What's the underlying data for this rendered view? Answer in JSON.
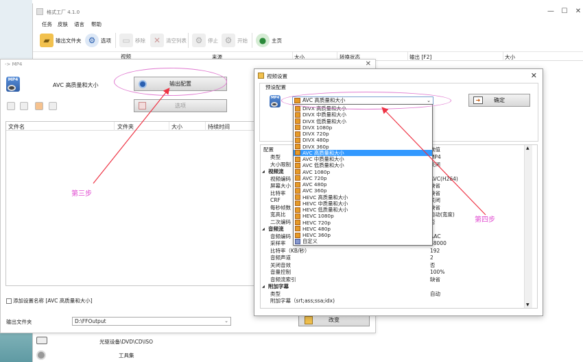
{
  "main_window": {
    "title": "格式工厂 4.1.0",
    "controls": {
      "minimize": "—",
      "maximize": "☐",
      "close": "✕"
    },
    "menu": [
      "任务",
      "皮肤",
      "语言",
      "帮助"
    ],
    "toolbar": {
      "output_folder": "输出文件夹",
      "options": "选项",
      "remove": "移除",
      "clear_list": "清空列表",
      "stop": "停止",
      "start": "开始",
      "home": "主页"
    },
    "list_columns": [
      "来源",
      "大小",
      "转换状态",
      "输出 [F2]",
      "大小"
    ],
    "video_label": "视频",
    "bottom_items": [
      "光驱设备\\DVD\\CD\\ISO",
      "工具集"
    ]
  },
  "mp4_window": {
    "title": "-> MP4",
    "profile_name": "AVC 高质量和大小",
    "output_config_button": "输出配置",
    "options_button": "选项",
    "file_columns": [
      "文件名",
      "文件夹",
      "大小",
      "持续时间"
    ],
    "add_setting_name": "添加设置名称 [AVC 高质量和大小]",
    "output_folder_label": "输出文件夹",
    "output_folder_value": "D:\\FFOutput",
    "change_button": "改变"
  },
  "video_dialog": {
    "title": "视频设置",
    "preset_label": "预设配置",
    "preset_selected": "AVC 高质量和大小",
    "ok_button": "确定",
    "grid_header": [
      "配置",
      "数值"
    ],
    "rows": [
      {
        "k": "类型",
        "v": "MP4",
        "cat": false
      },
      {
        "k": "大小限制（",
        "v": "关闭",
        "cat": false
      },
      {
        "k": "视频流",
        "v": "",
        "cat": true
      },
      {
        "k": "视频编码",
        "v": "AVC(H264)",
        "cat": false
      },
      {
        "k": "屏幕大小",
        "v": "缺省",
        "cat": false
      },
      {
        "k": "比特率",
        "v": "缺省",
        "cat": false
      },
      {
        "k": "CRF",
        "v": "关闭",
        "cat": false
      },
      {
        "k": "每秒帧数",
        "v": "缺省",
        "cat": false
      },
      {
        "k": "宽高比",
        "v": "自动(宽度)",
        "cat": false
      },
      {
        "k": "二次编码",
        "v": "否",
        "cat": false
      },
      {
        "k": "音频流",
        "v": "",
        "cat": true
      },
      {
        "k": "音频编码",
        "v": "AAC",
        "cat": false
      },
      {
        "k": "采样率",
        "v": "48000",
        "cat": false
      },
      {
        "k": "比特率（KB/秒）",
        "v": "192",
        "cat": false
      },
      {
        "k": "音频声道",
        "v": "2",
        "cat": false
      },
      {
        "k": "关闭音效",
        "v": "否",
        "cat": false
      },
      {
        "k": "音量控制",
        "v": "100%",
        "cat": false
      },
      {
        "k": "音频流索引",
        "v": "缺省",
        "cat": false
      },
      {
        "k": "附加字幕",
        "v": "",
        "cat": true
      },
      {
        "k": "类型",
        "v": "自动",
        "cat": false
      },
      {
        "k": "附加字幕（srt;ass;ssa;idx)",
        "v": "",
        "cat": false
      }
    ],
    "dropdown": [
      "DIVX 高质量和大小",
      "DIVX 中质量和大小",
      "DIVX 低质量和大小",
      "DIVX 1080p",
      "DIVX 720p",
      "DIVX 480p",
      "DIVX 360p",
      "AVC 高质量和大小",
      "AVC 中质量和大小",
      "AVC 低质量和大小",
      "AVC 1080p",
      "AVC 720p",
      "AVC 480p",
      "AVC 360p",
      "HEVC 高质量和大小",
      "HEVC 中质量和大小",
      "HEVC 低质量和大小",
      "HEVC 1080p",
      "HEVC 720p",
      "HEVC 480p",
      "HEVC 360p",
      "自定义"
    ],
    "dropdown_selected_index": 7
  },
  "annotations": {
    "step3": "第三步",
    "step4": "第四步",
    "color": "#e04ad0"
  }
}
